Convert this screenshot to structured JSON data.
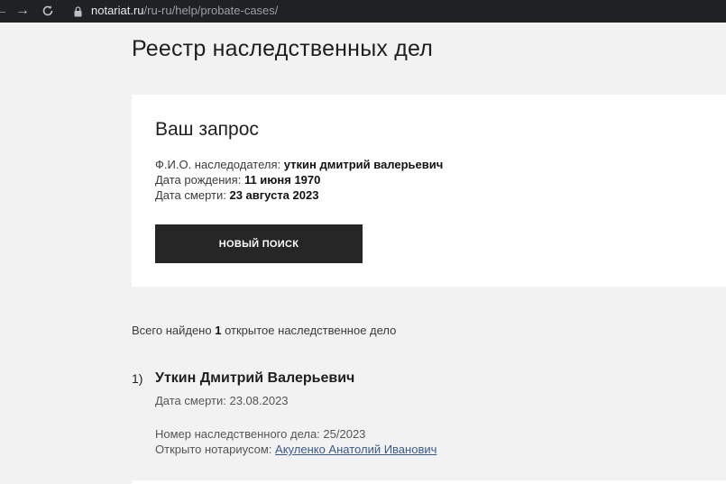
{
  "browser": {
    "url_host": "notariat.ru",
    "url_path": "/ru-ru/help/probate-cases/",
    "icons": {
      "back": "arrow-left-icon",
      "forward": "arrow-right-icon",
      "reload": "reload-icon",
      "secure": "lock-icon"
    }
  },
  "page": {
    "title": "Реестр наследственных дел"
  },
  "query": {
    "heading": "Ваш запрос",
    "fields": [
      {
        "label": "Ф.И.О. наследодателя:",
        "value": "уткин дмитрий валерьевич"
      },
      {
        "label": "Дата рождения:",
        "value": "11 июня 1970"
      },
      {
        "label": "Дата смерти:",
        "value": "23 августа 2023"
      }
    ],
    "new_search_label": "Новый поиск"
  },
  "summary": {
    "prefix": "Всего найдено",
    "count": "1",
    "suffix": "открытое наследственное дело"
  },
  "results": [
    {
      "index": "1)",
      "name": "Уткин Дмитрий Валерьевич",
      "death_date_label": "Дата смерти:",
      "death_date": "23.08.2023",
      "case_number_label": "Номер наследственного дела:",
      "case_number": "25/2023",
      "notary_label": "Открыто нотариусом:",
      "notary_name": "Акуленко Анатолий Иванович"
    }
  ],
  "colors": {
    "background": "#f2f2f2",
    "card": "#ffffff",
    "button": "#262626",
    "link": "#3a5a8c",
    "browser_bar": "#202124"
  }
}
